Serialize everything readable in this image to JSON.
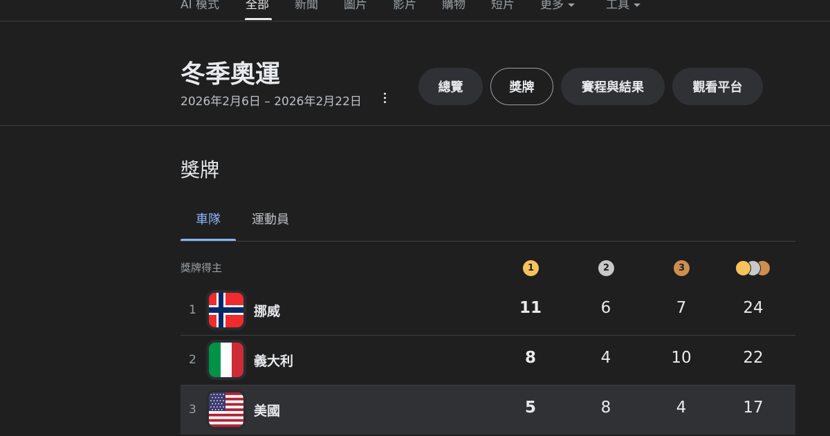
{
  "nav": {
    "items": [
      "AI 模式",
      "全部",
      "新聞",
      "圖片",
      "影片",
      "購物",
      "短片",
      "更多",
      "工具"
    ]
  },
  "event": {
    "title": "冬季奧運",
    "dates": "2026年2月6日 – 2026年2月22日"
  },
  "chips": [
    "總覽",
    "獎牌",
    "賽程與結果",
    "觀看平台"
  ],
  "medals_section": {
    "title": "獎牌",
    "tabs": [
      "車隊",
      "運動員"
    ],
    "column_label": "獎牌得主",
    "medal_icons": {
      "gold": "1",
      "silver": "2",
      "bronze": "3"
    },
    "colors": {
      "gold": "#f6c25b",
      "silver": "#c8c8c8",
      "bronze": "#cd8e4e",
      "accent": "#8ab4f8"
    },
    "rows": [
      {
        "rank": "1",
        "country": "挪威",
        "flag": "norway-flag-icon",
        "gold": "11",
        "silver": "6",
        "bronze": "7",
        "total": "24"
      },
      {
        "rank": "2",
        "country": "義大利",
        "flag": "italy-flag-icon",
        "gold": "8",
        "silver": "4",
        "bronze": "10",
        "total": "22"
      },
      {
        "rank": "3",
        "country": "美國",
        "flag": "usa-flag-icon",
        "gold": "5",
        "silver": "8",
        "bronze": "4",
        "total": "17"
      }
    ]
  }
}
